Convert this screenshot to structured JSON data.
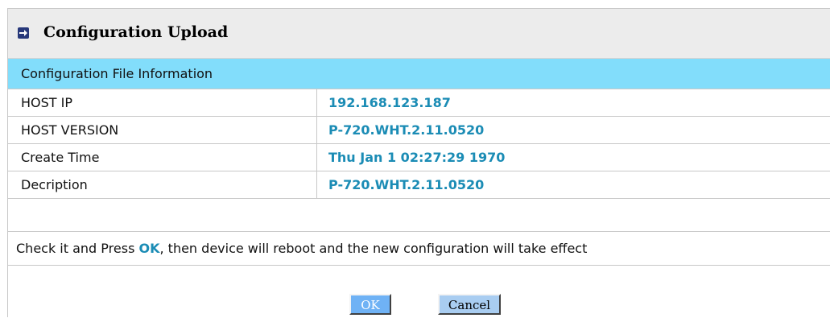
{
  "page": {
    "title": "Configuration Upload",
    "title_icon": "arrow-right-icon"
  },
  "section": {
    "header": "Configuration File Information"
  },
  "info_rows": [
    {
      "label": "HOST IP",
      "value": "192.168.123.187"
    },
    {
      "label": "HOST VERSION",
      "value": "P-720.WHT.2.11.0520"
    },
    {
      "label": "Create Time",
      "value": "Thu Jan 1 02:27:29 1970"
    },
    {
      "label": "Decription",
      "value": "P-720.WHT.2.11.0520"
    }
  ],
  "notice": {
    "prefix": "Check it and Press ",
    "ok_word": "OK",
    "suffix": ", then device will reboot and the new configuration will take effect"
  },
  "buttons": {
    "ok_label": "OK",
    "cancel_label": "Cancel"
  },
  "colors": {
    "header_bg": "#82ddfb",
    "value_text": "#1b8cb5",
    "title_bar_bg": "#ececec",
    "ok_button_bg": "#6fb2f5",
    "cancel_button_bg": "#a9cdf1"
  }
}
